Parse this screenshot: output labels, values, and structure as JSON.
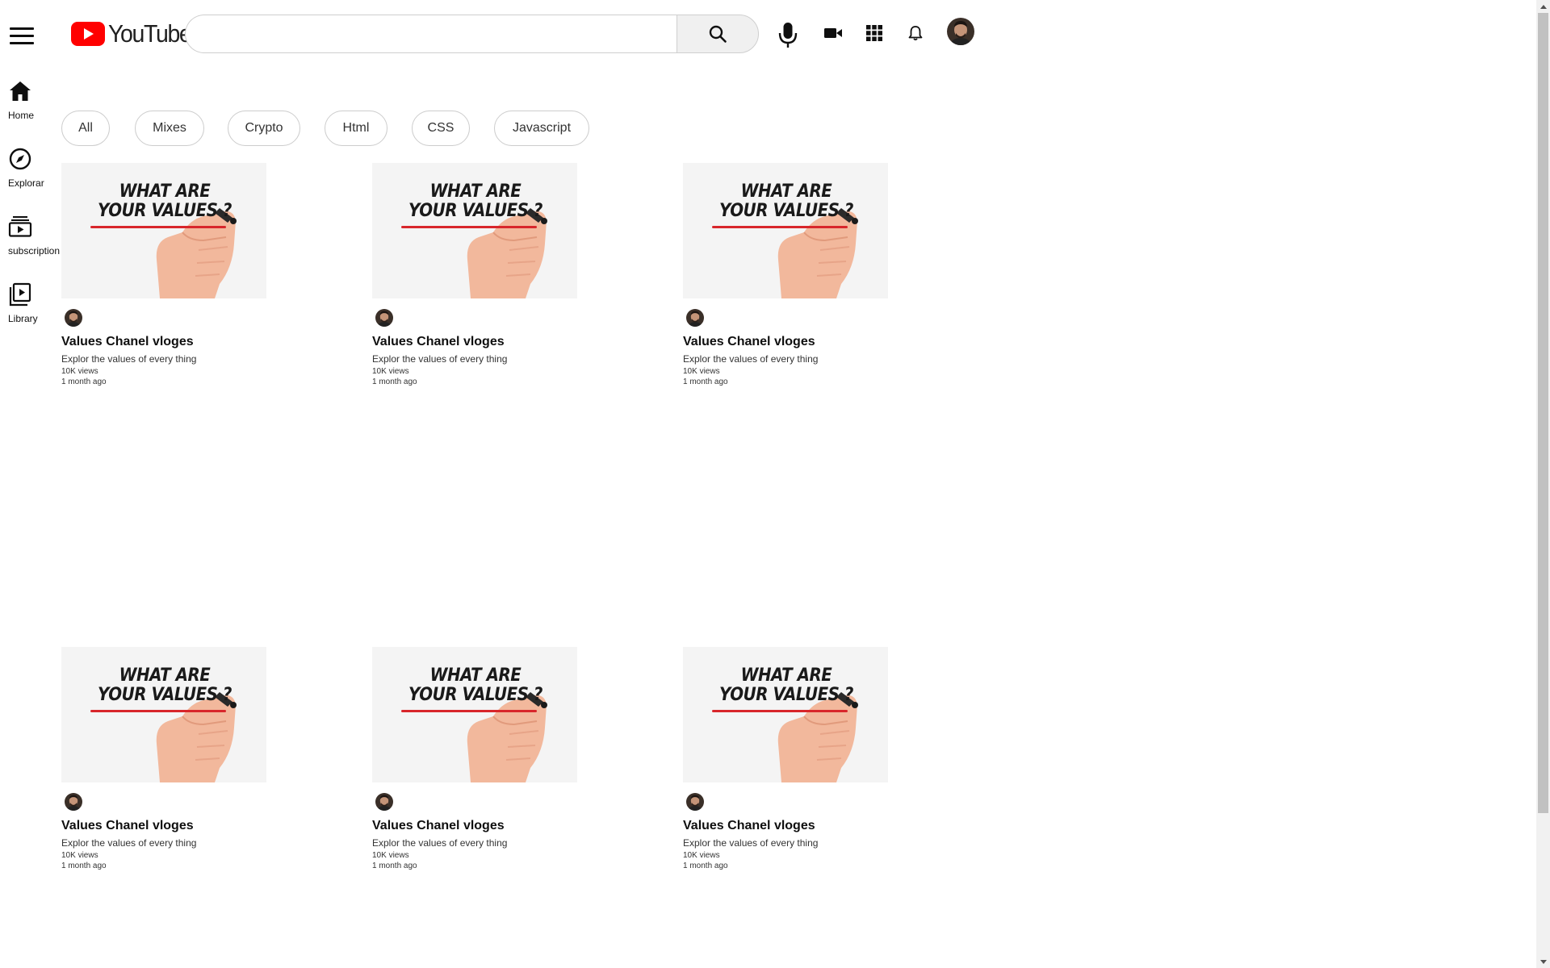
{
  "header": {
    "menu_icon": "hamburger-menu-icon",
    "logo_text": "YouTube",
    "search_placeholder": "",
    "search_value": "",
    "icons": [
      "search-icon",
      "microphone-icon",
      "video-camera-icon",
      "apps-grid-icon",
      "bell-icon",
      "avatar"
    ]
  },
  "sidebar": {
    "items": [
      {
        "label": "Home",
        "icon": "home-icon"
      },
      {
        "label": "Explorar",
        "icon": "compass-icon"
      },
      {
        "label": "subscription",
        "icon": "subscriptions-icon"
      },
      {
        "label": "Library",
        "icon": "library-icon"
      }
    ]
  },
  "chips": [
    "All",
    "Mixes",
    "Crypto",
    "Html",
    "CSS",
    "Javascript"
  ],
  "videos": [
    {
      "thumb_line1": "WHAT ARE",
      "thumb_line2": "YOUR VALUES ?",
      "title": "Values Chanel vloges",
      "description": "Explor the values of every thing",
      "views": "10K views",
      "age": "1 month ago"
    },
    {
      "thumb_line1": "WHAT ARE",
      "thumb_line2": "YOUR VALUES ?",
      "title": "Values Chanel vloges",
      "description": "Explor the values of every thing",
      "views": "10K views",
      "age": "1 month ago"
    },
    {
      "thumb_line1": "WHAT ARE",
      "thumb_line2": "YOUR VALUES ?",
      "title": "Values Chanel vloges",
      "description": "Explor the values of every thing",
      "views": "10K views",
      "age": "1 month ago"
    },
    {
      "thumb_line1": "WHAT ARE",
      "thumb_line2": "YOUR VALUES ?",
      "title": "Values Chanel vloges",
      "description": "Explor the values of every thing",
      "views": "10K views",
      "age": "1 month ago"
    },
    {
      "thumb_line1": "WHAT ARE",
      "thumb_line2": "YOUR VALUES ?",
      "title": "Values Chanel vloges",
      "description": "Explor the values of every thing",
      "views": "10K views",
      "age": "1 month ago"
    },
    {
      "thumb_line1": "WHAT ARE",
      "thumb_line2": "YOUR VALUES ?",
      "title": "Values Chanel vloges",
      "description": "Explor the values of every thing",
      "views": "10K views",
      "age": "1 month ago"
    }
  ],
  "colors": {
    "brand_red": "#ff0000",
    "thumb_underline": "#d8262b",
    "search_button_bg": "#f0f0f0"
  }
}
